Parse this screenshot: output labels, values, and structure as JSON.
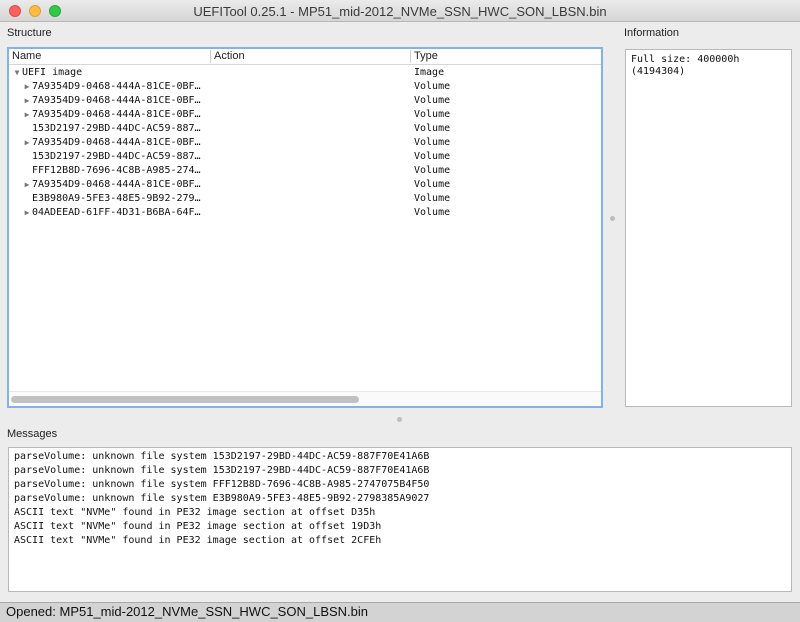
{
  "window": {
    "title": "UEFITool 0.25.1 - MP51_mid-2012_NVMe_SSN_HWC_SON_LBSN.bin"
  },
  "structure": {
    "label": "Structure",
    "columns": {
      "name": "Name",
      "action": "Action",
      "type": "Type"
    },
    "rows": [
      {
        "name": "UEFI image",
        "type": "Image",
        "arrow": "down",
        "level": 0
      },
      {
        "name": "7A9354D9-0468-444A-81CE-0BF…",
        "type": "Volume",
        "arrow": "right",
        "level": 1
      },
      {
        "name": "7A9354D9-0468-444A-81CE-0BF…",
        "type": "Volume",
        "arrow": "right",
        "level": 1
      },
      {
        "name": "7A9354D9-0468-444A-81CE-0BF…",
        "type": "Volume",
        "arrow": "right",
        "level": 1
      },
      {
        "name": "153D2197-29BD-44DC-AC59-887…",
        "type": "Volume",
        "arrow": "none",
        "level": 1
      },
      {
        "name": "7A9354D9-0468-444A-81CE-0BF…",
        "type": "Volume",
        "arrow": "right",
        "level": 1
      },
      {
        "name": "153D2197-29BD-44DC-AC59-887…",
        "type": "Volume",
        "arrow": "none",
        "level": 1
      },
      {
        "name": "FFF12B8D-7696-4C8B-A985-274…",
        "type": "Volume",
        "arrow": "none",
        "level": 1
      },
      {
        "name": "7A9354D9-0468-444A-81CE-0BF…",
        "type": "Volume",
        "arrow": "right",
        "level": 1
      },
      {
        "name": "E3B980A9-5FE3-48E5-9B92-279…",
        "type": "Volume",
        "arrow": "none",
        "level": 1
      },
      {
        "name": "04ADEEAD-61FF-4D31-B6BA-64F…",
        "type": "Volume",
        "arrow": "right",
        "level": 1
      }
    ]
  },
  "information": {
    "label": "Information",
    "text": "Full size: 400000h\n(4194304)"
  },
  "messages": {
    "label": "Messages",
    "lines": [
      "parseVolume: unknown file system 153D2197-29BD-44DC-AC59-887F70E41A6B",
      "parseVolume: unknown file system 153D2197-29BD-44DC-AC59-887F70E41A6B",
      "parseVolume: unknown file system FFF12B8D-7696-4C8B-A985-2747075B4F50",
      "parseVolume: unknown file system E3B980A9-5FE3-48E5-9B92-2798385A9027",
      "ASCII text \"NVMe\" found in PE32 image section at offset D35h",
      "ASCII text \"NVMe\" found in PE32 image section at offset 19D3h",
      "ASCII text \"NVMe\" found in PE32 image section at offset 2CFEh"
    ]
  },
  "status": {
    "text": "Opened: MP51_mid-2012_NVMe_SSN_HWC_SON_LBSN.bin"
  },
  "colors": {
    "focus_ring": "#82b2ea",
    "close": "#fc605c",
    "minimize": "#fdbc40",
    "maximize": "#34c84a"
  }
}
